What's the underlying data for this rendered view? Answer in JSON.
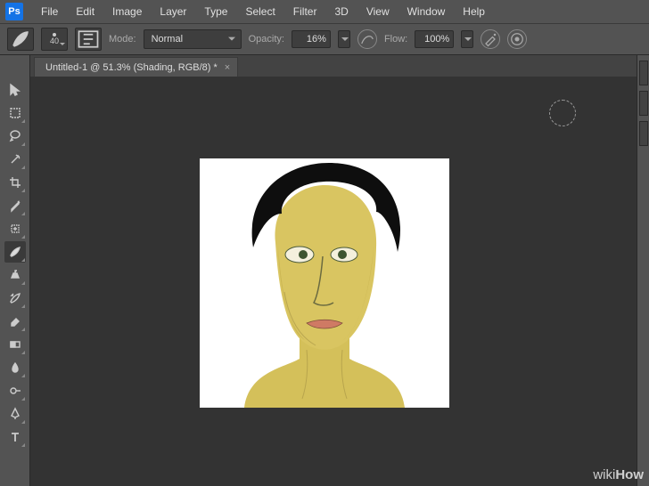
{
  "app": {
    "logo": "Ps"
  },
  "menu": {
    "items": [
      "File",
      "Edit",
      "Image",
      "Layer",
      "Type",
      "Select",
      "Filter",
      "3D",
      "View",
      "Window",
      "Help"
    ]
  },
  "options": {
    "brush_size": "40",
    "mode_label": "Mode:",
    "mode_value": "Normal",
    "opacity_label": "Opacity:",
    "opacity_value": "16%",
    "flow_label": "Flow:",
    "flow_value": "100%"
  },
  "document": {
    "tab_title": "Untitled-1 @ 51.3% (Shading, RGB/8) *",
    "close_glyph": "×"
  },
  "watermark": {
    "a": "wiki",
    "b": "How"
  }
}
